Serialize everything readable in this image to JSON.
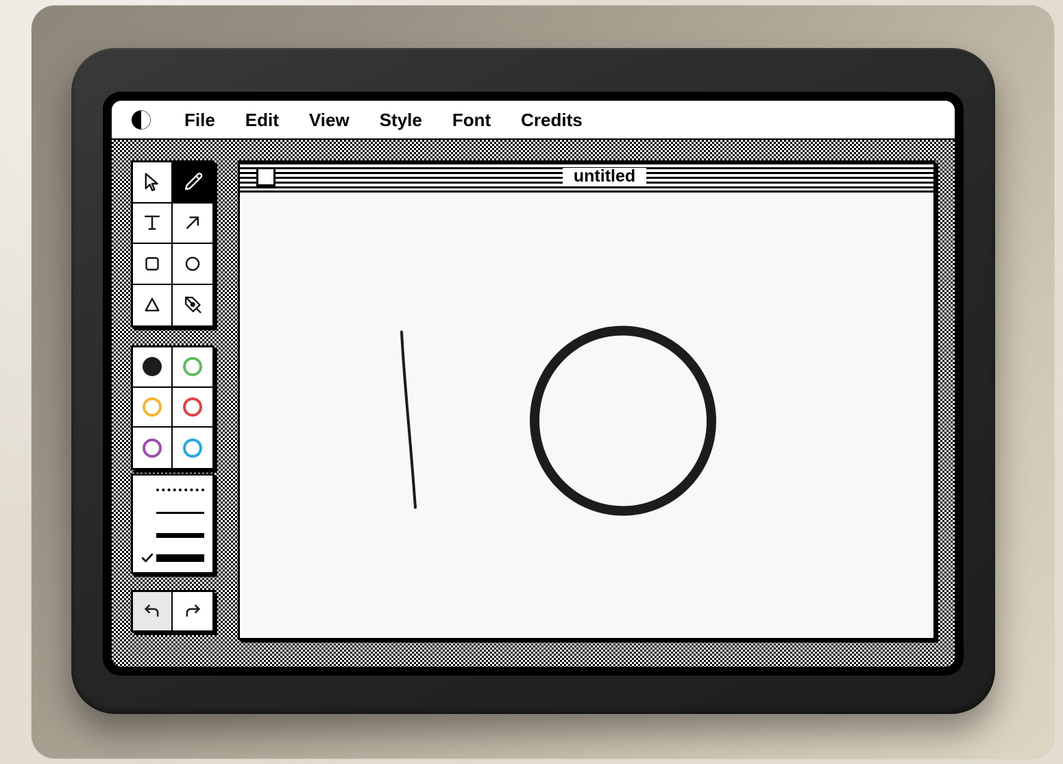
{
  "app": {
    "window_title": "untitled"
  },
  "menubar": {
    "logo_icon": "contrast-circle-icon",
    "items": [
      {
        "label": "File"
      },
      {
        "label": "Edit"
      },
      {
        "label": "View"
      },
      {
        "label": "Style"
      },
      {
        "label": "Font"
      },
      {
        "label": "Credits"
      }
    ]
  },
  "tools": {
    "items": [
      {
        "name": "select",
        "icon": "cursor-arrow-icon",
        "label": "Select",
        "active": false
      },
      {
        "name": "pencil",
        "icon": "pencil-icon",
        "label": "Pencil",
        "active": true
      },
      {
        "name": "text",
        "icon": "text-icon",
        "label": "Text",
        "active": false
      },
      {
        "name": "arrow",
        "icon": "arrow-icon",
        "label": "Arrow",
        "active": false
      },
      {
        "name": "rectangle",
        "icon": "rectangle-icon",
        "label": "Rectangle",
        "active": false
      },
      {
        "name": "ellipse",
        "icon": "ellipse-icon",
        "label": "Ellipse",
        "active": false
      },
      {
        "name": "triangle",
        "icon": "triangle-icon",
        "label": "Triangle",
        "active": false
      },
      {
        "name": "pen",
        "icon": "pen-nib-icon",
        "label": "Pen",
        "active": false
      }
    ]
  },
  "colors": {
    "items": [
      {
        "name": "black",
        "hex": "#1c1c1c",
        "label": "Black",
        "selected": true
      },
      {
        "name": "green",
        "hex": "#5fbd5c",
        "label": "Green",
        "selected": false
      },
      {
        "name": "orange",
        "hex": "#f5b335",
        "label": "Orange",
        "selected": false
      },
      {
        "name": "red",
        "hex": "#dc4444",
        "label": "Red",
        "selected": false
      },
      {
        "name": "purple",
        "hex": "#9b4fa8",
        "label": "Purple",
        "selected": false
      },
      {
        "name": "blue",
        "hex": "#25a8de",
        "label": "Blue",
        "selected": false
      }
    ]
  },
  "strokes": {
    "items": [
      {
        "name": "dotted",
        "label": "Dotted",
        "selected": false
      },
      {
        "name": "thin",
        "label": "Thin",
        "selected": false
      },
      {
        "name": "medium",
        "label": "Medium",
        "selected": false
      },
      {
        "name": "thick",
        "label": "Thick",
        "selected": true
      }
    ]
  },
  "history": {
    "undo": {
      "icon": "undo-arrow-icon",
      "label": "Undo",
      "dim": true
    },
    "redo": {
      "icon": "redo-arrow-icon",
      "label": "Redo",
      "dim": false
    }
  },
  "canvas": {
    "background": "#f7f8fa",
    "shapes": [
      {
        "name": "freehand-line",
        "type": "line",
        "stroke": "#1c1c1c",
        "stroke_width": 4
      },
      {
        "name": "freehand-circle",
        "type": "circle",
        "stroke": "#1c1c1c",
        "stroke_width": 14
      }
    ]
  }
}
